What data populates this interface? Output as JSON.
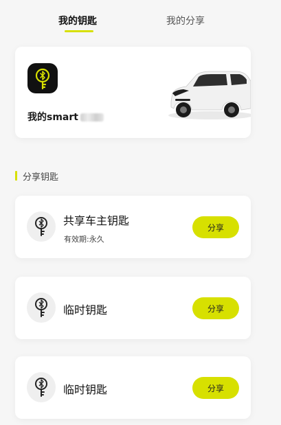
{
  "tabs": [
    {
      "label": "我的钥匙",
      "active": true
    },
    {
      "label": "我的分享",
      "active": false
    }
  ],
  "car_card": {
    "name": "我的smart",
    "icon": "bluetooth-key-icon"
  },
  "section": {
    "title": "分享钥匙"
  },
  "keys": [
    {
      "title": "共享车主钥匙",
      "validity_label": "有效期:",
      "validity_value": "永久",
      "share_label": "分享"
    },
    {
      "title": "临时钥匙",
      "share_label": "分享"
    },
    {
      "title": "临时钥匙",
      "share_label": "分享"
    }
  ],
  "colors": {
    "accent": "#d7e000",
    "background": "#f6f6f6",
    "card": "#ffffff",
    "badge": "#111111"
  }
}
